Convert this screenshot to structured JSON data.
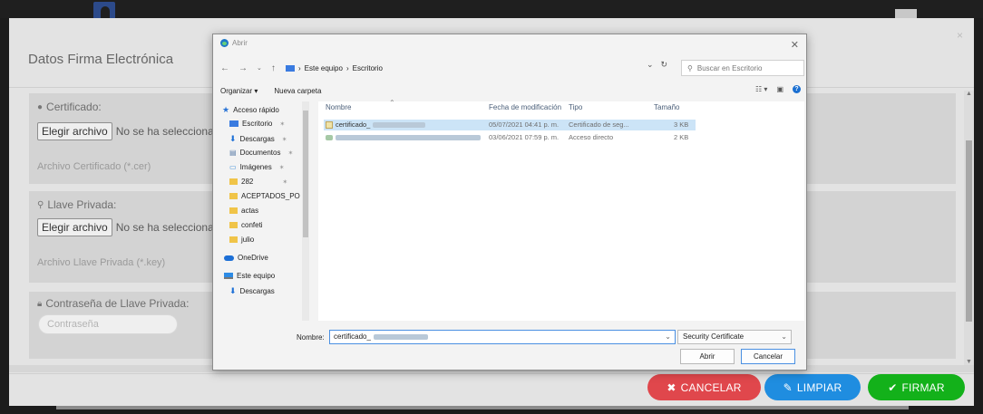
{
  "modal": {
    "title": "Datos Firma Electrónica",
    "close": "×",
    "cert": {
      "label": "Certificado:",
      "button": "Elegir archivo",
      "status": "No se ha seleccionado",
      "hint": "Archivo Certificado (*.cer)"
    },
    "key": {
      "label": "Llave Privada:",
      "button": "Elegir archivo",
      "status": "No se ha seleccionado",
      "hint": "Archivo Llave Privada (*.key)"
    },
    "password": {
      "label": "Contraseña de Llave Privada:",
      "placeholder": "Contraseña"
    },
    "footer": {
      "cancel": "CANCELAR",
      "clear": "LIMPIAR",
      "sign": "FIRMAR"
    },
    "colors": {
      "cancel": "#e0474c",
      "clear": "#1f8de0",
      "sign": "#13b11a"
    }
  },
  "dialog": {
    "title": "Abrir",
    "breadcrumb": [
      "Este equipo",
      "Escritorio"
    ],
    "search_placeholder": "Buscar en Escritorio",
    "toolbar": {
      "organize": "Organizar ▾",
      "new_folder": "Nueva carpeta"
    },
    "nav": [
      {
        "label": "Acceso rápido",
        "icon": "star-icon"
      },
      {
        "label": "Escritorio",
        "icon": "desktop-folder-icon"
      },
      {
        "label": "Descargas",
        "icon": "download-icon"
      },
      {
        "label": "Documentos",
        "icon": "documents-icon"
      },
      {
        "label": "Imágenes",
        "icon": "images-icon"
      },
      {
        "label": "282",
        "icon": "folder-icon"
      },
      {
        "label": "ACEPTADOS_PO",
        "icon": "folder-icon"
      },
      {
        "label": "actas",
        "icon": "folder-icon"
      },
      {
        "label": "confeti",
        "icon": "folder-icon"
      },
      {
        "label": "julio",
        "icon": "folder-icon"
      },
      {
        "label": "OneDrive",
        "icon": "onedrive-icon"
      },
      {
        "label": "Este equipo",
        "icon": "this-pc-icon"
      },
      {
        "label": "Descargas",
        "icon": "download-icon"
      }
    ],
    "columns": [
      "Nombre",
      "Fecha de modificación",
      "Tipo",
      "Tamaño"
    ],
    "files": [
      {
        "name": "certificado_",
        "date": "05/07/2021 04:41 p. m.",
        "type": "Certificado de seg...",
        "size": "3 KB"
      },
      {
        "name": "",
        "date": "03/06/2021 07:59 p. m.",
        "type": "Acceso directo",
        "size": "2 KB"
      }
    ],
    "filename_label": "Nombre:",
    "filename_value": "certificado_",
    "filter": "Security Certificate",
    "open": "Abrir",
    "cancel": "Cancelar"
  }
}
